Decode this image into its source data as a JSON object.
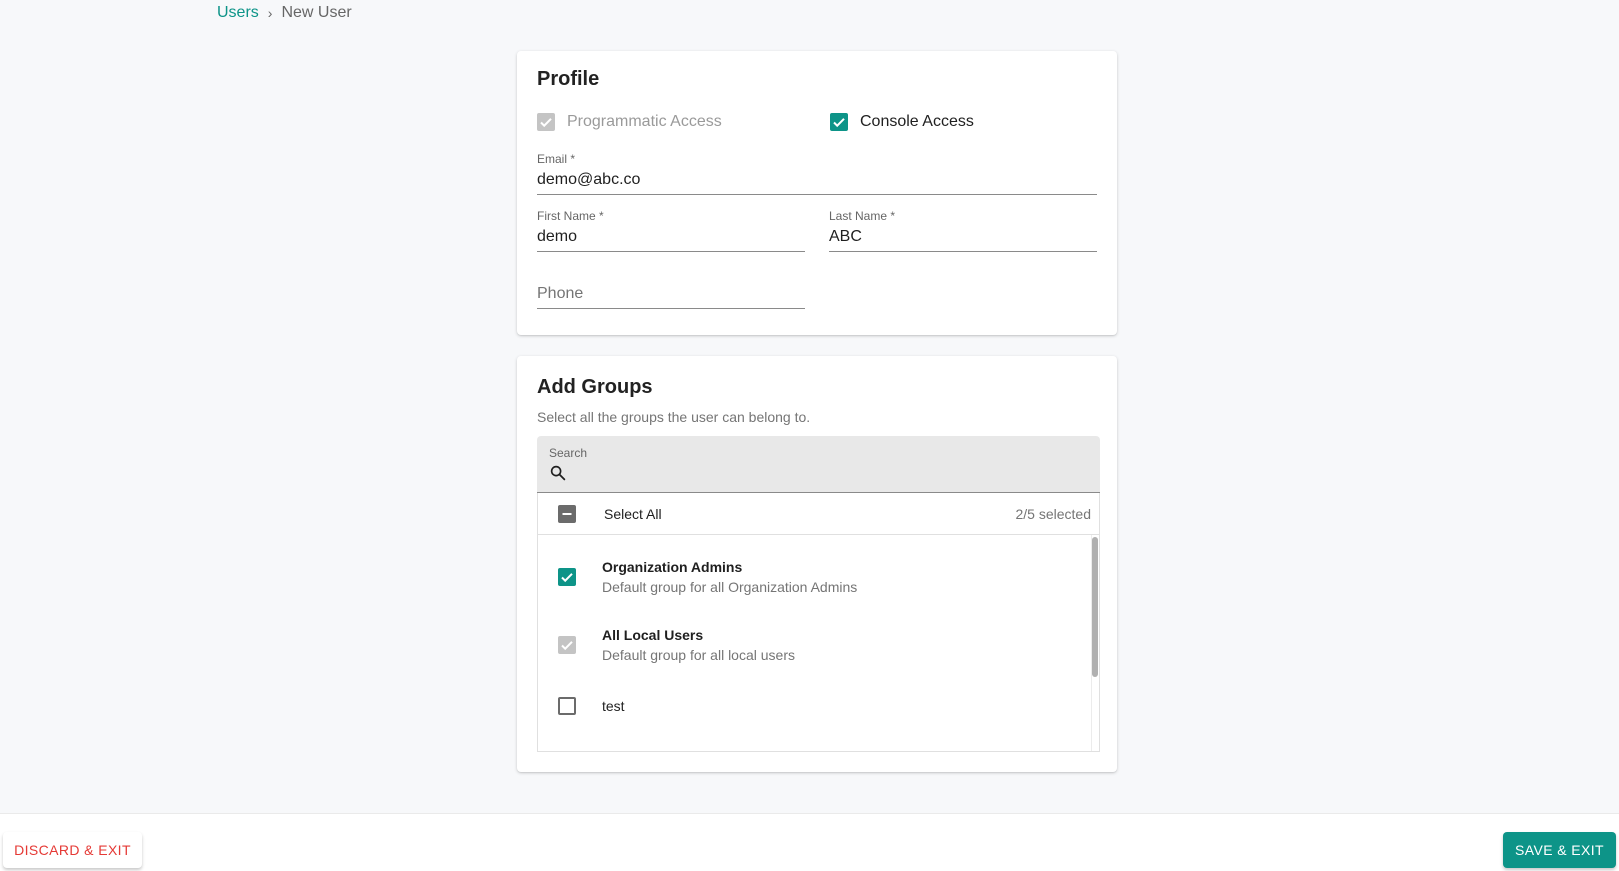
{
  "breadcrumb": {
    "parent": "Users",
    "separator": "›",
    "current": "New User"
  },
  "profile": {
    "title": "Profile",
    "programmatic_access": {
      "label": "Programmatic Access",
      "checked": true,
      "disabled": true
    },
    "console_access": {
      "label": "Console Access",
      "checked": true,
      "disabled": false
    },
    "email": {
      "label": "Email *",
      "value": "demo@abc.co"
    },
    "first_name": {
      "label": "First Name *",
      "value": "demo"
    },
    "last_name": {
      "label": "Last Name *",
      "value": "ABC"
    },
    "phone": {
      "label": "Phone",
      "value": ""
    }
  },
  "groups": {
    "title": "Add Groups",
    "description": "Select all the groups the user can belong to.",
    "search": {
      "label": "Search",
      "value": "",
      "icon": "search-icon"
    },
    "select_all": {
      "label": "Select All",
      "state": "indeterminate"
    },
    "selected_count": "2/5 selected",
    "items": [
      {
        "name": "Organization Admins",
        "description": "Default group for all Organization Admins",
        "state": "checked"
      },
      {
        "name": "All Local Users",
        "description": "Default group for all local users",
        "state": "disabled-checked"
      },
      {
        "name": "test",
        "description": "",
        "state": "unchecked"
      }
    ]
  },
  "footer": {
    "discard_label": "DISCARD & EXIT",
    "save_label": "SAVE & EXIT"
  },
  "colors": {
    "accent": "#0d9488",
    "danger": "#e53935",
    "disabled": "#c4c4c4"
  }
}
